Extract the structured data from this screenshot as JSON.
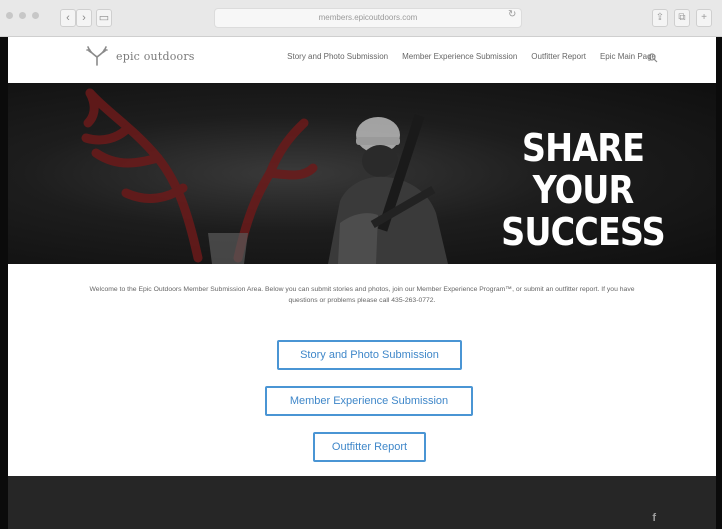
{
  "browser": {
    "url": "members.epicoutdoors.com"
  },
  "header": {
    "logo_text": "epic outdoors",
    "nav": [
      {
        "label": "Story and Photo Submission"
      },
      {
        "label": "Member Experience Submission"
      },
      {
        "label": "Outfitter Report"
      },
      {
        "label": "Epic Main Page"
      }
    ]
  },
  "hero": {
    "title_line1": "SHARE YOUR",
    "title_line2": "SUCCESS"
  },
  "main": {
    "welcome": "Welcome to the Epic Outdoors Member Submission Area. Below you can submit stories and photos, join our Member Experience Program™, or submit an outfitter report. If you have questions or problems please call 435-263-0772.",
    "buttons": [
      {
        "label": "Story and Photo Submission"
      },
      {
        "label": "Member Experience Submission"
      },
      {
        "label": "Outfitter Report"
      }
    ]
  },
  "footer": {
    "social_icon": "facebook-icon"
  },
  "colors": {
    "button_border": "#4a95d4",
    "button_text": "#3f87c9",
    "footer_bg": "#262626",
    "antler_red": "#6b1a1a"
  }
}
